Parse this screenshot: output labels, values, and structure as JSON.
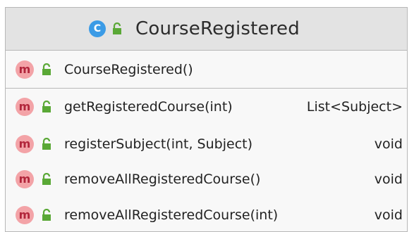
{
  "class": {
    "stereotype_badge": "C",
    "name": "CourseRegistered"
  },
  "constructors": [
    {
      "badge": "m",
      "name": "CourseRegistered()",
      "type": ""
    }
  ],
  "methods": [
    {
      "badge": "m",
      "name": "getRegisteredCourse(int)",
      "type": "List<Subject>"
    },
    {
      "badge": "m",
      "name": "registerSubject(int, Subject)",
      "type": "void"
    },
    {
      "badge": "m",
      "name": "removeAllRegisteredCourse()",
      "type": "void"
    },
    {
      "badge": "m",
      "name": "removeAllRegisteredCourse(int)",
      "type": "void"
    }
  ],
  "icons": {
    "class_badge": "class-c-icon",
    "method_badge": "method-m-icon",
    "visibility": "public-lock-icon"
  },
  "colors": {
    "header_bg": "#e3e3e3",
    "body_bg": "#f8f8f8",
    "class_badge": "#3b9be6",
    "method_badge": "#f3a3a7",
    "method_badge_text": "#b2263b",
    "lock": "#5aa836"
  }
}
